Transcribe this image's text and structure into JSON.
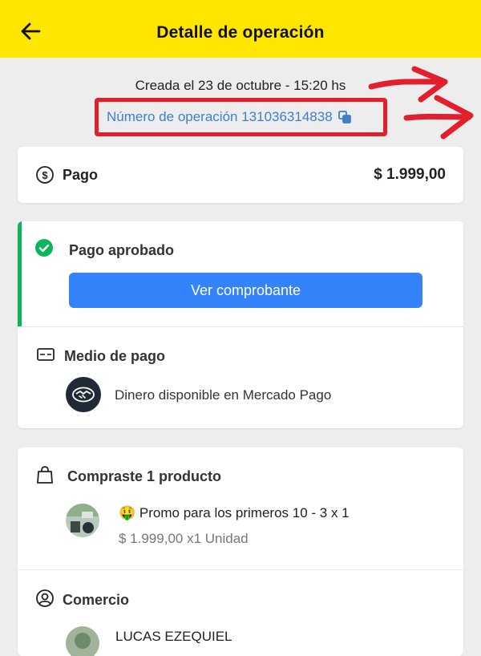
{
  "header": {
    "title": "Detalle de operación",
    "back_icon": "arrow-left-icon",
    "background": "#ffe600"
  },
  "operation": {
    "created": "Creada el 23 de octubre - 15:20 hs",
    "number_text": "Número de operación 131036314838",
    "copy_icon": "copy-icon",
    "link_color": "#3f7fc9"
  },
  "annotation": {
    "highlight_color": "#e21f2d"
  },
  "payment": {
    "label": "Pago",
    "amount": "$ 1.999,00",
    "icon": "dollar-circle-icon"
  },
  "status": {
    "label": "Pago aprobado",
    "icon": "check-circle-icon",
    "accent": "#0bb55a",
    "button_label": "Ver comprobante",
    "button_color": "#3483fa"
  },
  "payment_method": {
    "title": "Medio de pago",
    "icon": "card-icon",
    "method": "Dinero disponible en Mercado Pago",
    "method_icon": "handshake-icon"
  },
  "purchase": {
    "title": "Compraste 1 producto",
    "icon": "shopping-bag-icon",
    "emoji": "🤑",
    "product_name": "Promo para los primeros 10 - 3 x 1",
    "price_line": "$ 1.999,00 x1 Unidad"
  },
  "merchant": {
    "title": "Comercio",
    "icon": "user-circle-icon",
    "name": "LUCAS EZEQUIEL"
  }
}
